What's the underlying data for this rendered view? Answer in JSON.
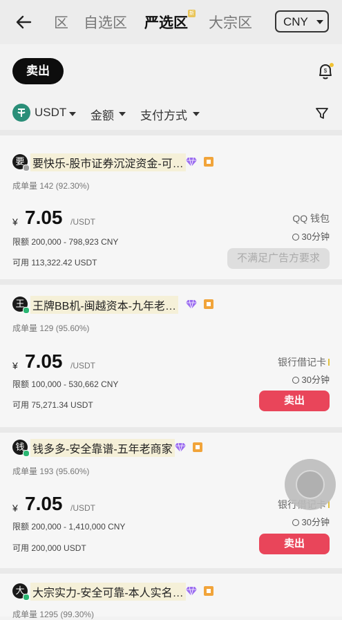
{
  "header": {
    "tabs": [
      "区",
      "自选区",
      "严选区",
      "大宗区"
    ],
    "active_tab": "严选区",
    "tab_badge": "新",
    "currency": "CNY"
  },
  "action": {
    "sell_label": "卖出"
  },
  "filters": {
    "asset": "USDT",
    "amount": "金额",
    "payment": "支付方式"
  },
  "listings": [
    {
      "avatar": "要",
      "status_color": "#9e9e9e",
      "name": "要快乐-股市证券沉淀资金-可…",
      "orders": "成单量  142 (92.30%)",
      "currency_symbol": "¥",
      "price": "7.05",
      "unit": "/USDT",
      "limit": "限额  200,000 - 798,923 CNY",
      "available": "可用  113,322.42 USDT",
      "payment": "QQ 钱包",
      "time": "30分钟",
      "button": "不满足广告方要求",
      "button_state": "disabled"
    },
    {
      "avatar": "王",
      "status_color": "#2bb673",
      "name": "王牌BB机-闽越资本-九年老…",
      "orders": "成单量  129 (95.60%)",
      "currency_symbol": "¥",
      "price": "7.05",
      "unit": "/USDT",
      "limit": "限额  100,000 - 530,662 CNY",
      "available": "可用  75,271.34 USDT",
      "payment": "银行借记卡",
      "time": "30分钟",
      "button": "卖出",
      "button_state": "sell"
    },
    {
      "avatar": "钱",
      "status_color": "#2bb673",
      "name": "钱多多-安全靠谱-五年老商家",
      "orders": "成单量  193 (95.60%)",
      "currency_symbol": "¥",
      "price": "7.05",
      "unit": "/USDT",
      "limit": "限额  200,000 - 1,410,000 CNY",
      "available": "可用  200,000 USDT",
      "payment": "银行借记卡",
      "time": "30分钟",
      "button": "卖出",
      "button_state": "sell"
    },
    {
      "avatar": "大",
      "status_color": "#2bb673",
      "name": "大宗实力-安全可靠-本人实名…",
      "orders": "成单量  1295 (99.30%)"
    }
  ],
  "colors": {
    "sell": "#e9455a",
    "usdt": "#2a8e78",
    "shop_badge": "#f1a43a",
    "diamond": "#9b6cf0"
  }
}
